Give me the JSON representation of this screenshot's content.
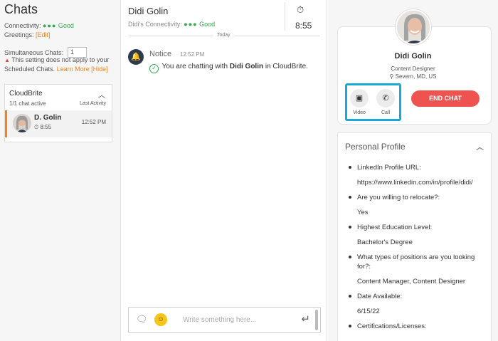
{
  "left": {
    "title": "Chats",
    "connectivity_label": "Connectivity:",
    "connectivity_status": "Good",
    "greetings_label": "Greetings:",
    "greetings_edit": "[Edit]",
    "simultaneous_label": "Simultaneous Chats:",
    "simultaneous_value": "1",
    "warning_text": "This setting does not apply to your Scheduled Chats.",
    "learn_more": "Learn More",
    "hide": "[Hide]",
    "group": {
      "name": "CloudBrite",
      "active": "1/1 chat active",
      "last_activity": "Last Activity",
      "chat": {
        "name": "D. Golin",
        "timer": "8:55",
        "time": "12:52 PM"
      }
    }
  },
  "middle": {
    "name": "Didi Golin",
    "connectivity_label": "Didi's Connectivity:",
    "connectivity_status": "Good",
    "timer": "8:55",
    "date_divider": "Today",
    "notice": {
      "title": "Notice",
      "time": "12:52 PM",
      "msg_prefix": "You are chatting with",
      "msg_name": "Didi Golin",
      "msg_suffix": "in CloudBrite."
    },
    "composer": {
      "placeholder": "Write something here..."
    }
  },
  "right": {
    "profile": {
      "name": "Didi Golin",
      "role": "Content Designer",
      "location": "Severn, MD, US"
    },
    "video_label": "Video",
    "call_label": "Call",
    "end_chat": "END CHAT",
    "personal_profile": {
      "title": "Personal Profile",
      "items": [
        {
          "q": "LinkedIn Profile URL:",
          "a": "https://www.linkedin.com/in/profile/didi/",
          "link": true
        },
        {
          "q": "Are you willing to relocate?:",
          "a": "Yes"
        },
        {
          "q": "Highest Education Level:",
          "a": "Bachelor's Degree"
        },
        {
          "q": "What types of positions are you looking for?:",
          "a": "Content Manager, Content Designer"
        },
        {
          "q": "Date Available:",
          "a": "6/15/22"
        },
        {
          "q": "Certifications/Licenses:",
          "a": ""
        }
      ]
    }
  },
  "colors": {
    "accent": "#f0831f",
    "good": "#2ea84a",
    "end_chat": "#ef5350",
    "highlight": "#17a9d9"
  }
}
